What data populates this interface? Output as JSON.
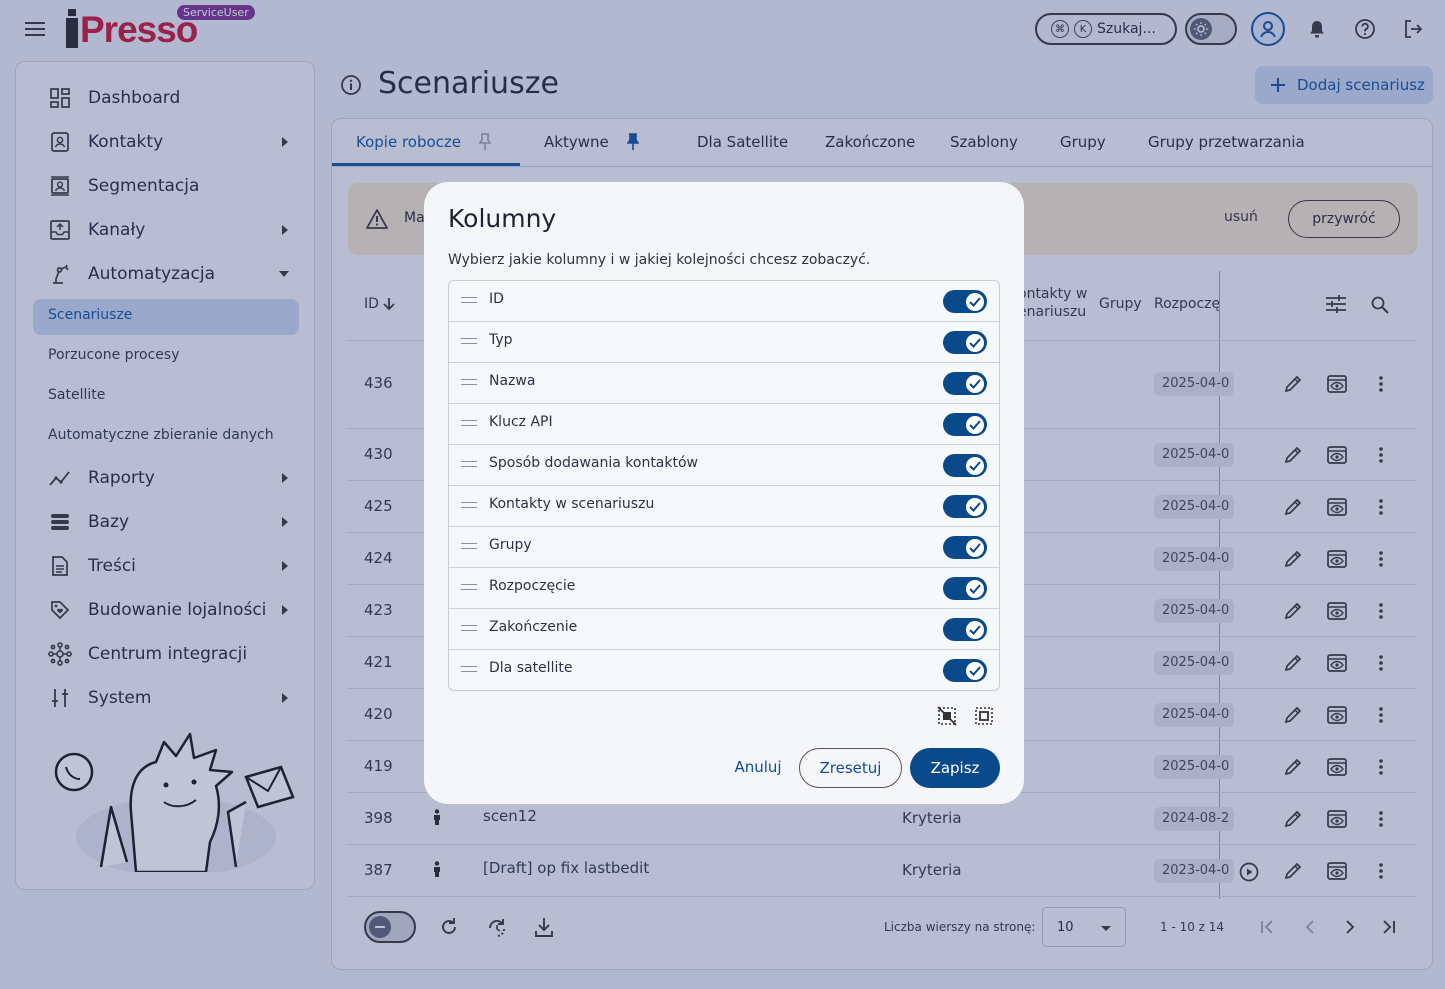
{
  "header": {
    "logo": "Presso",
    "role_badge": "ServiceUser",
    "search_placeholder": "Szukaj...",
    "kbd_cmd": "⌘",
    "kbd_k": "K"
  },
  "sidebar": {
    "items": [
      {
        "label": "Dashboard"
      },
      {
        "label": "Kontakty"
      },
      {
        "label": "Segmentacja"
      },
      {
        "label": "Kanały"
      },
      {
        "label": "Automatyzacja"
      },
      {
        "label": "Raporty"
      },
      {
        "label": "Bazy"
      },
      {
        "label": "Treści"
      },
      {
        "label": "Budowanie lojalności"
      },
      {
        "label": "Centrum integracji"
      },
      {
        "label": "System"
      }
    ],
    "sub_items": [
      {
        "label": "Scenariusze"
      },
      {
        "label": "Porzucone procesy"
      },
      {
        "label": "Satellite"
      },
      {
        "label": "Automatyczne zbieranie danych"
      }
    ]
  },
  "main": {
    "title": "Scenariusze",
    "add_button": "Dodaj scenariusz",
    "tabs": [
      {
        "label": "Kopie robocze"
      },
      {
        "label": "Aktywne"
      },
      {
        "label": "Dla Satellite"
      },
      {
        "label": "Zakończone"
      },
      {
        "label": "Szablony"
      },
      {
        "label": "Grupy"
      },
      {
        "label": "Grupy przetwarzania"
      }
    ],
    "banner": {
      "text_visible": "Ma",
      "delete": "usuń",
      "restore": "przywróć"
    },
    "table": {
      "headers": {
        "id": "ID",
        "contacts_line1": "ontakty w",
        "contacts_line2": "enariuszu",
        "groups": "Grupy",
        "start": "Rozpoczęc"
      },
      "rows": [
        {
          "id": "436",
          "name": "",
          "type": "",
          "date": "2025-04-0"
        },
        {
          "id": "430",
          "name": "",
          "type": "",
          "date": "2025-04-0"
        },
        {
          "id": "425",
          "name": "",
          "type": "",
          "date": "2025-04-0"
        },
        {
          "id": "424",
          "name": "",
          "type": "",
          "date": "2025-04-0"
        },
        {
          "id": "423",
          "name": "",
          "type": "",
          "date": "2025-04-0"
        },
        {
          "id": "421",
          "name": "",
          "type": "",
          "date": "2025-04-0"
        },
        {
          "id": "420",
          "name": "",
          "type": "",
          "date": "2025-04-0"
        },
        {
          "id": "419",
          "name": "",
          "type": "",
          "date": "2025-04-0"
        },
        {
          "id": "398",
          "name": "scen12",
          "type": "Kryteria",
          "date": "2024-08-2"
        },
        {
          "id": "387",
          "name": "[Draft] op fix lastbedit",
          "type": "Kryteria",
          "date": "2023-04-0"
        }
      ]
    },
    "footer": {
      "rows_per_page_label": "Liczba wierszy na stronę:",
      "rows_per_page_value": "10",
      "range": "1 - 10 z 14"
    }
  },
  "modal": {
    "title": "Kolumny",
    "description": "Wybierz jakie kolumny i w jakiej kolejności chcesz zobaczyć.",
    "columns": [
      {
        "label": "ID",
        "enabled": true
      },
      {
        "label": "Typ",
        "enabled": true
      },
      {
        "label": "Nazwa",
        "enabled": true
      },
      {
        "label": "Klucz API",
        "enabled": true
      },
      {
        "label": "Sposób dodawania kontaktów",
        "enabled": true
      },
      {
        "label": "Kontakty w scenariuszu",
        "enabled": true
      },
      {
        "label": "Grupy",
        "enabled": true
      },
      {
        "label": "Rozpoczęcie",
        "enabled": true
      },
      {
        "label": "Zakończenie",
        "enabled": true
      },
      {
        "label": "Dla satellite",
        "enabled": true
      }
    ],
    "cancel": "Anuluj",
    "reset": "Zresetuj",
    "save": "Zapisz"
  },
  "colors": {
    "primary": "#0b4a8a",
    "accent_light": "#c7d6ed",
    "brand_red": "#c8102e",
    "badge_purple": "#7b2d8e",
    "warning_bg": "#f0e3c9"
  }
}
